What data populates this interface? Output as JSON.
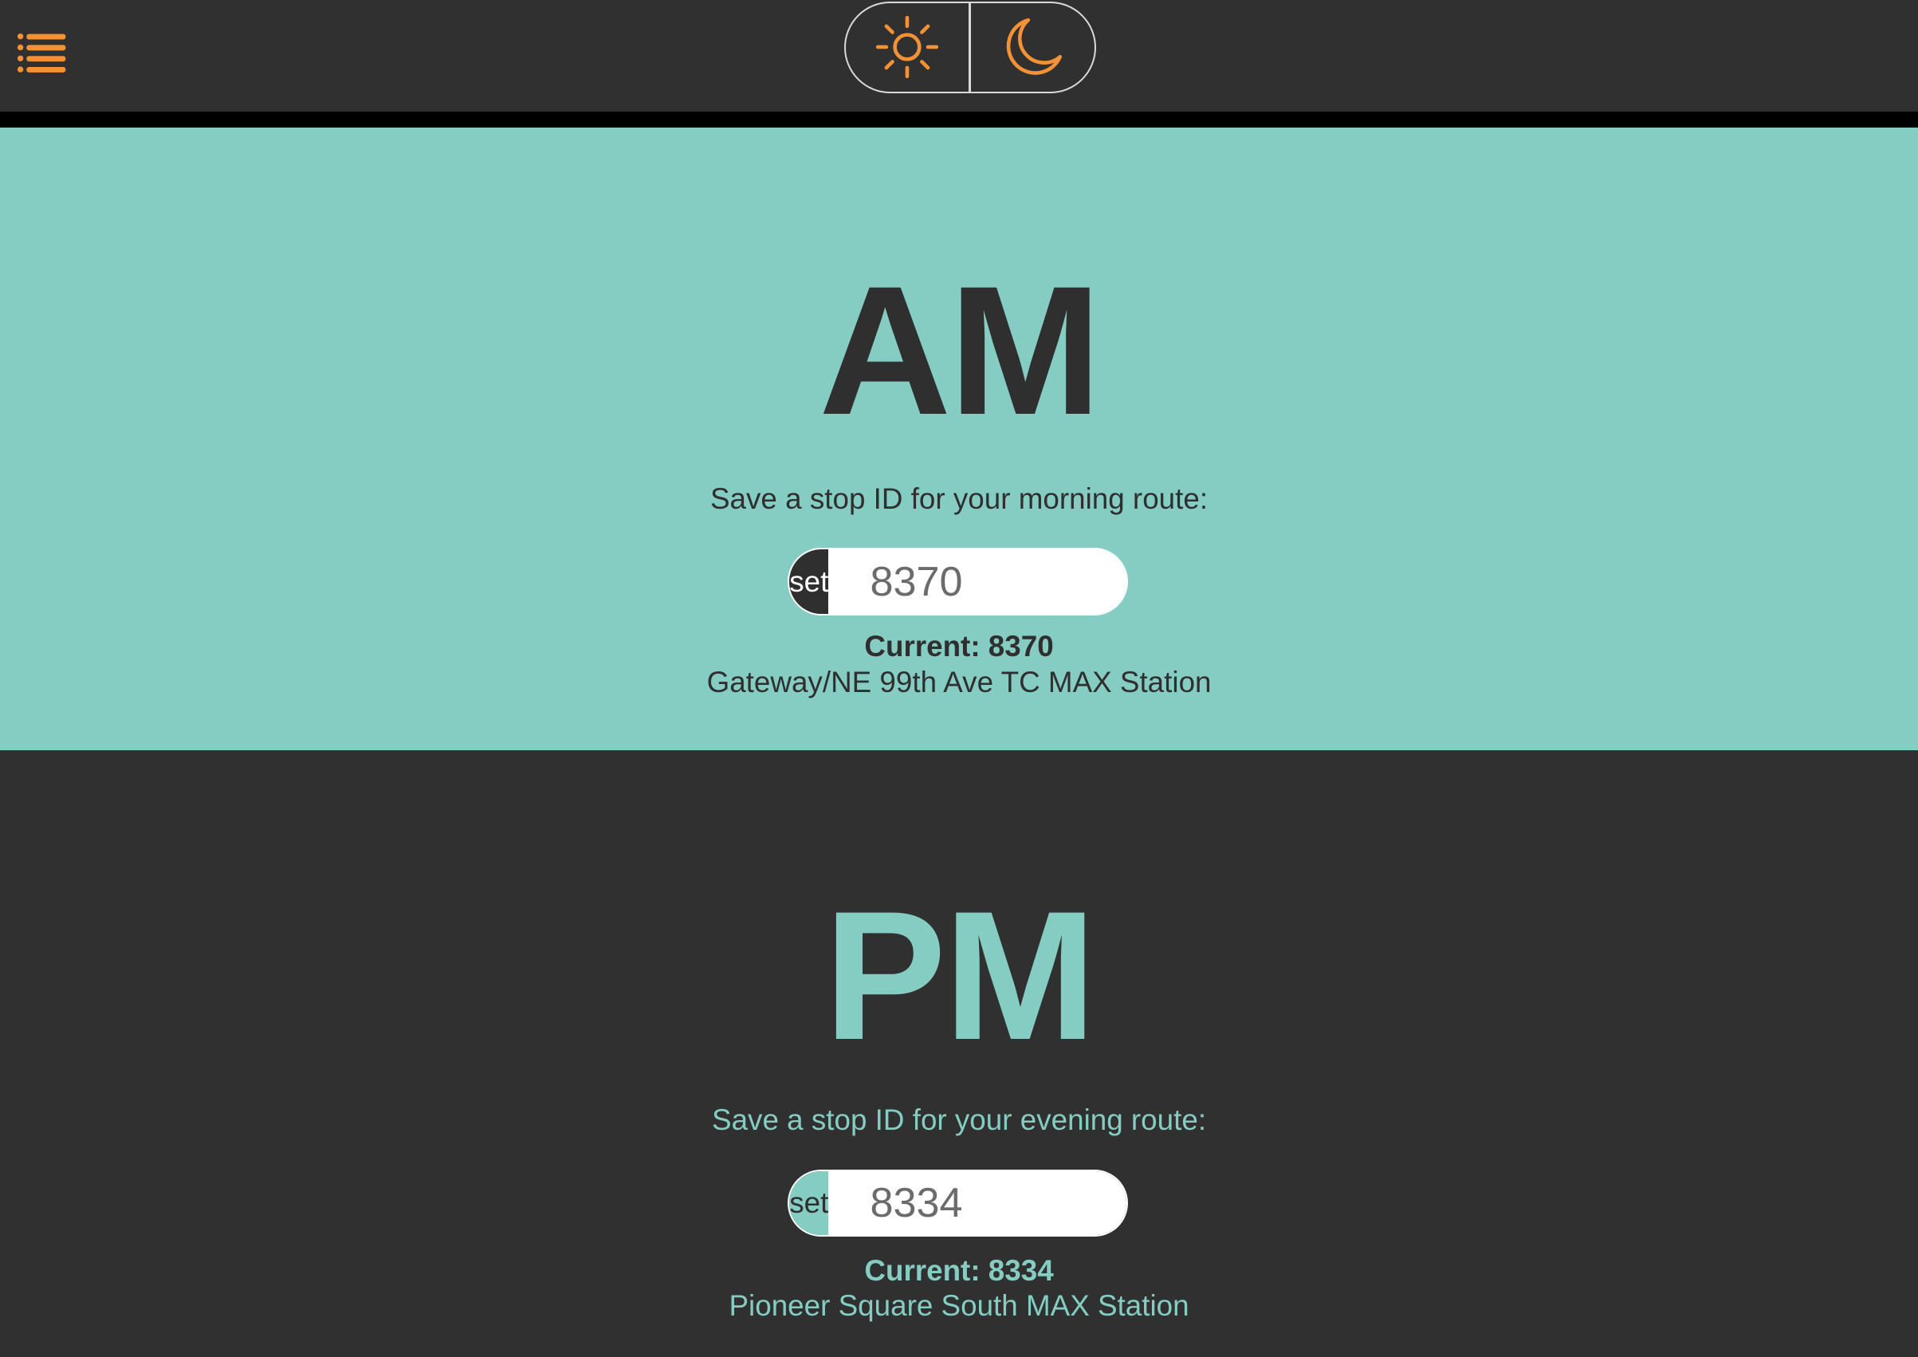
{
  "header": {
    "menu_icon": "hamburger-list-icon",
    "theme_toggle": {
      "light_icon": "sun-icon",
      "dark_icon": "moon-icon",
      "icon_color": "#f39234"
    }
  },
  "colors": {
    "accent": "#85cdc3",
    "dark": "#303030",
    "orange": "#f39234",
    "divider": "#000000"
  },
  "am": {
    "title": "AM",
    "prompt": "Save a stop ID for your morning route:",
    "set_label": "set",
    "input_value": "8370",
    "current_label": "Current: 8370",
    "station_name": "Gateway/NE 99th Ave TC MAX Station"
  },
  "pm": {
    "title": "PM",
    "prompt": "Save a stop ID for your evening route:",
    "set_label": "set",
    "input_value": "8334",
    "current_label": "Current: 8334",
    "station_name": "Pioneer Square South MAX Station"
  }
}
